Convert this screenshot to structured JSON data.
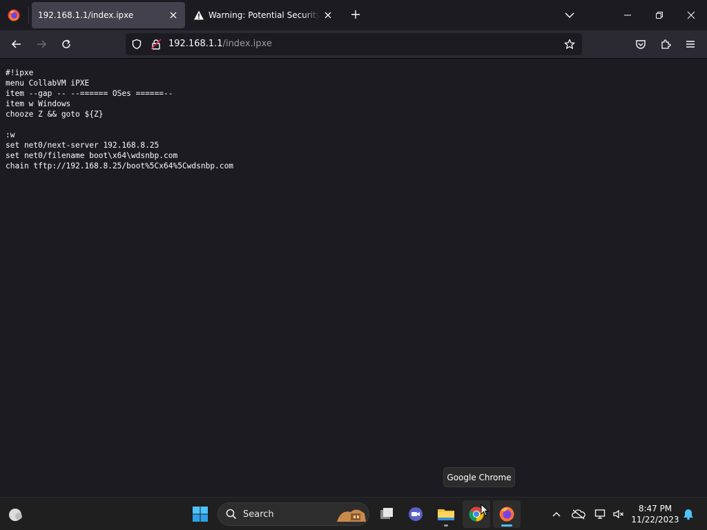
{
  "browser": {
    "tabs": [
      {
        "title": "192.168.1.1/index.ipxe",
        "active": true
      },
      {
        "title": "Warning: Potential Security Risk Ahead",
        "active": false
      }
    ],
    "url": {
      "host": "192.168.1.1",
      "path": "/index.ipxe"
    }
  },
  "page": {
    "lines": [
      "#!ipxe",
      "menu CollabVM iPXE",
      "item --gap -- --====== OSes ======--",
      "item w Windows",
      "chooze Z && goto ${Z}",
      "",
      ":w",
      "set net0/next-server 192.168.8.25",
      "set net0/filename boot\\x64\\wdsnbp.com",
      "chain tftp://192.168.8.25/boot%5Cx64%5Cwdsnbp.com"
    ]
  },
  "tooltip": {
    "text": "Google Chrome"
  },
  "taskbar": {
    "search_label": "Search",
    "clock": {
      "time": "8:47 PM",
      "date": "11/22/2023"
    },
    "apps": [
      "start-icon",
      "search-icon",
      "task-view-icon",
      "teams-meet-icon",
      "file-explorer-icon",
      "chrome-icon",
      "firefox-icon"
    ]
  },
  "colors": {
    "accent": "#4cc2ff",
    "warning": "#fbfbfe",
    "background": "#1c1b22"
  }
}
